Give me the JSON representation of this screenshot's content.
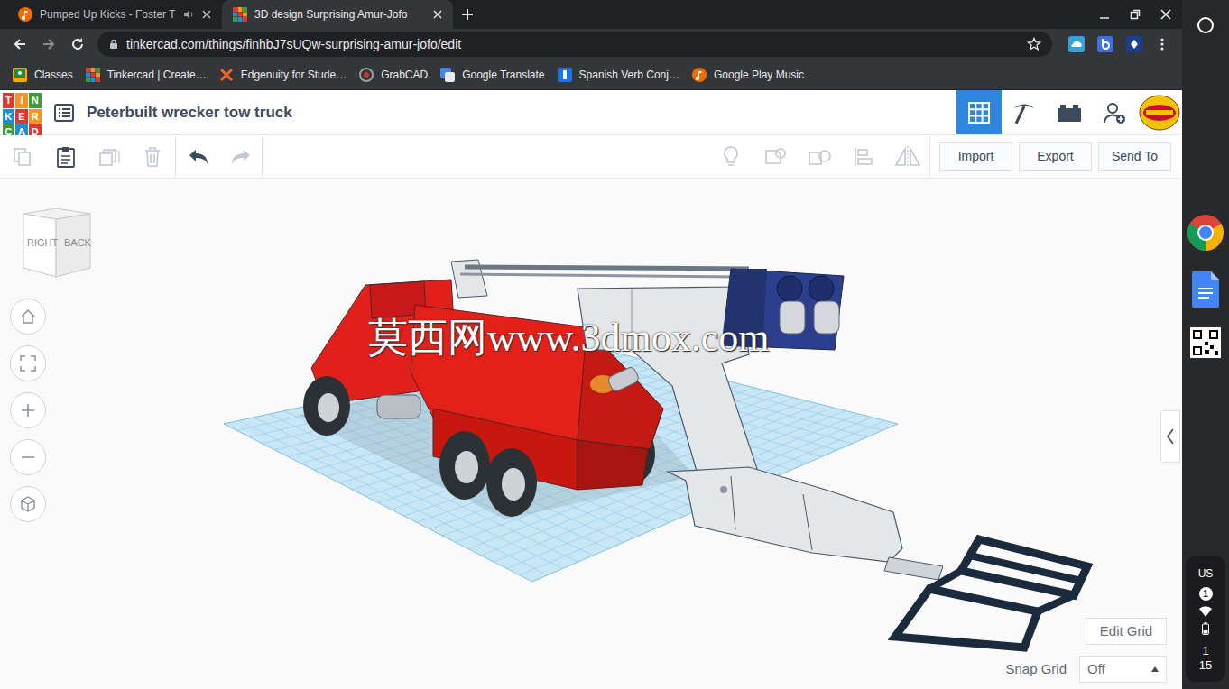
{
  "tabs": [
    {
      "label": "Pumped Up Kicks - Foster T",
      "selected": false
    },
    {
      "label": "3D design Surprising Amur-Jofo",
      "selected": true
    }
  ],
  "address_bar": {
    "url": "tinkercad.com/things/finhbJ7sUQw-surprising-amur-jofo/edit"
  },
  "bookmarks": [
    {
      "label": "Classes"
    },
    {
      "label": "Tinkercad | Create…"
    },
    {
      "label": "Edgenuity for Stude…"
    },
    {
      "label": "GrabCAD"
    },
    {
      "label": "Google Translate"
    },
    {
      "label": "Spanish Verb Conj…"
    },
    {
      "label": "Google Play Music"
    }
  ],
  "app": {
    "logo": [
      "T",
      "I",
      "N",
      "K",
      "E",
      "R",
      "C",
      "A",
      "D"
    ],
    "title": "Peterbuilt wrecker tow truck"
  },
  "view_modes": [
    {
      "kind": "design",
      "selected": true
    },
    {
      "kind": "build",
      "selected": false
    },
    {
      "kind": "bricks",
      "selected": false
    }
  ],
  "clipboard_tools": [
    {
      "kind": "copy",
      "enabled": false
    },
    {
      "kind": "paste",
      "enabled": true
    },
    {
      "kind": "duplicate",
      "enabled": false
    },
    {
      "kind": "delete",
      "enabled": false
    }
  ],
  "history_tools": [
    {
      "kind": "undo",
      "enabled": true
    },
    {
      "kind": "redo",
      "enabled": false
    }
  ],
  "shape_tools": [
    {
      "kind": "note",
      "enabled": false
    },
    {
      "kind": "group",
      "enabled": false
    },
    {
      "kind": "ungroup",
      "enabled": false
    },
    {
      "kind": "align",
      "enabled": false
    },
    {
      "kind": "mirror",
      "enabled": false
    }
  ],
  "actions": [
    "Import",
    "Export",
    "Send To"
  ],
  "view_cube": {
    "left_face": "RIGHT",
    "right_face": "BACK"
  },
  "watermark": "莫西网www.3dmox.com",
  "grid": {
    "edit_button": "Edit Grid",
    "snap_label": "Snap Grid",
    "snap_value": "Off"
  },
  "shelf": {
    "keyboard": "US",
    "notifications": "1",
    "time_hour": "1",
    "time_minute": "15"
  }
}
